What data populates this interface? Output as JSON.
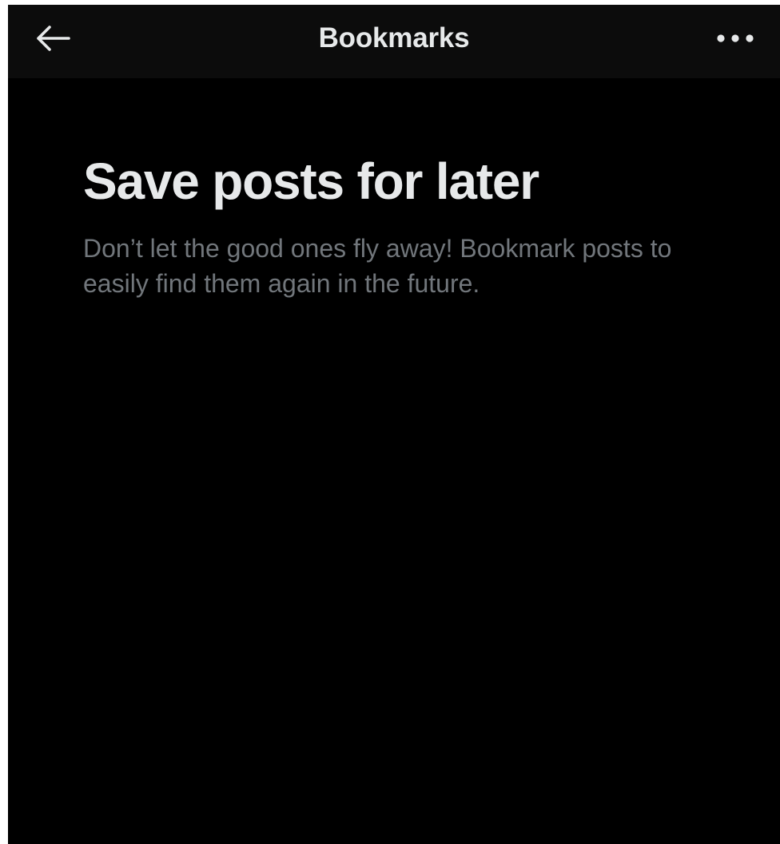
{
  "header": {
    "title": "Bookmarks",
    "back_icon": "arrow-left-icon",
    "more_icon": "more-horizontal-icon"
  },
  "empty_state": {
    "title": "Save posts for later",
    "description": "Don’t let the good ones fly away! Bookmark posts to easily find them again in the future."
  },
  "colors": {
    "background": "#000000",
    "header_background": "#0c0c0c",
    "primary_text": "#e7e9ea",
    "secondary_text": "#71767b"
  }
}
